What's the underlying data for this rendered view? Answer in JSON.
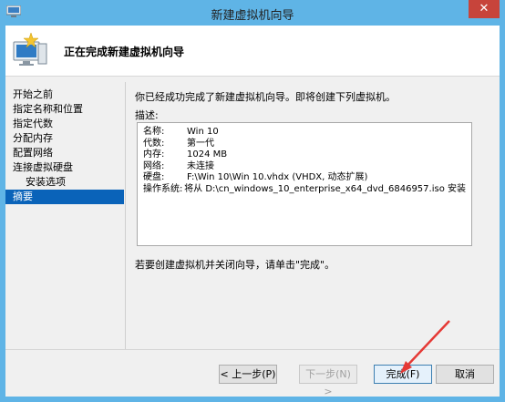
{
  "window": {
    "title": "新建虚拟机向导",
    "close_glyph": "✕"
  },
  "header": {
    "title": "正在完成新建虚拟机向导"
  },
  "nav": {
    "items": [
      {
        "label": "开始之前",
        "sub": false,
        "active": false
      },
      {
        "label": "指定名称和位置",
        "sub": false,
        "active": false
      },
      {
        "label": "指定代数",
        "sub": false,
        "active": false
      },
      {
        "label": "分配内存",
        "sub": false,
        "active": false
      },
      {
        "label": "配置网络",
        "sub": false,
        "active": false
      },
      {
        "label": "连接虚拟硬盘",
        "sub": false,
        "active": false
      },
      {
        "label": "安装选项",
        "sub": true,
        "active": false
      },
      {
        "label": "摘要",
        "sub": false,
        "active": true
      }
    ]
  },
  "main": {
    "intro": "你已经成功完成了新建虚拟机向导。即将创建下列虚拟机。",
    "desc_label": "描述:",
    "details": [
      {
        "key": "名称:",
        "value": "Win 10"
      },
      {
        "key": "代数:",
        "value": "第一代"
      },
      {
        "key": "内存:",
        "value": "1024 MB"
      },
      {
        "key": "网络:",
        "value": "未连接"
      },
      {
        "key": "硬盘:",
        "value": "F:\\Win 10\\Win 10.vhdx (VHDX, 动态扩展)"
      },
      {
        "key": "操作系统:",
        "value": "将从 D:\\cn_windows_10_enterprise_x64_dvd_6846957.iso 安装"
      }
    ],
    "finish_note": "若要创建虚拟机并关闭向导，请单击\"完成\"。"
  },
  "buttons": {
    "prev": "< 上一步(P)",
    "next": "下一步(N) >",
    "finish": "完成(F)",
    "cancel": "取消"
  },
  "colors": {
    "title_bar": "#5fb4e6",
    "active_nav": "#0a63b9",
    "annotation_arrow": "#e53935"
  }
}
